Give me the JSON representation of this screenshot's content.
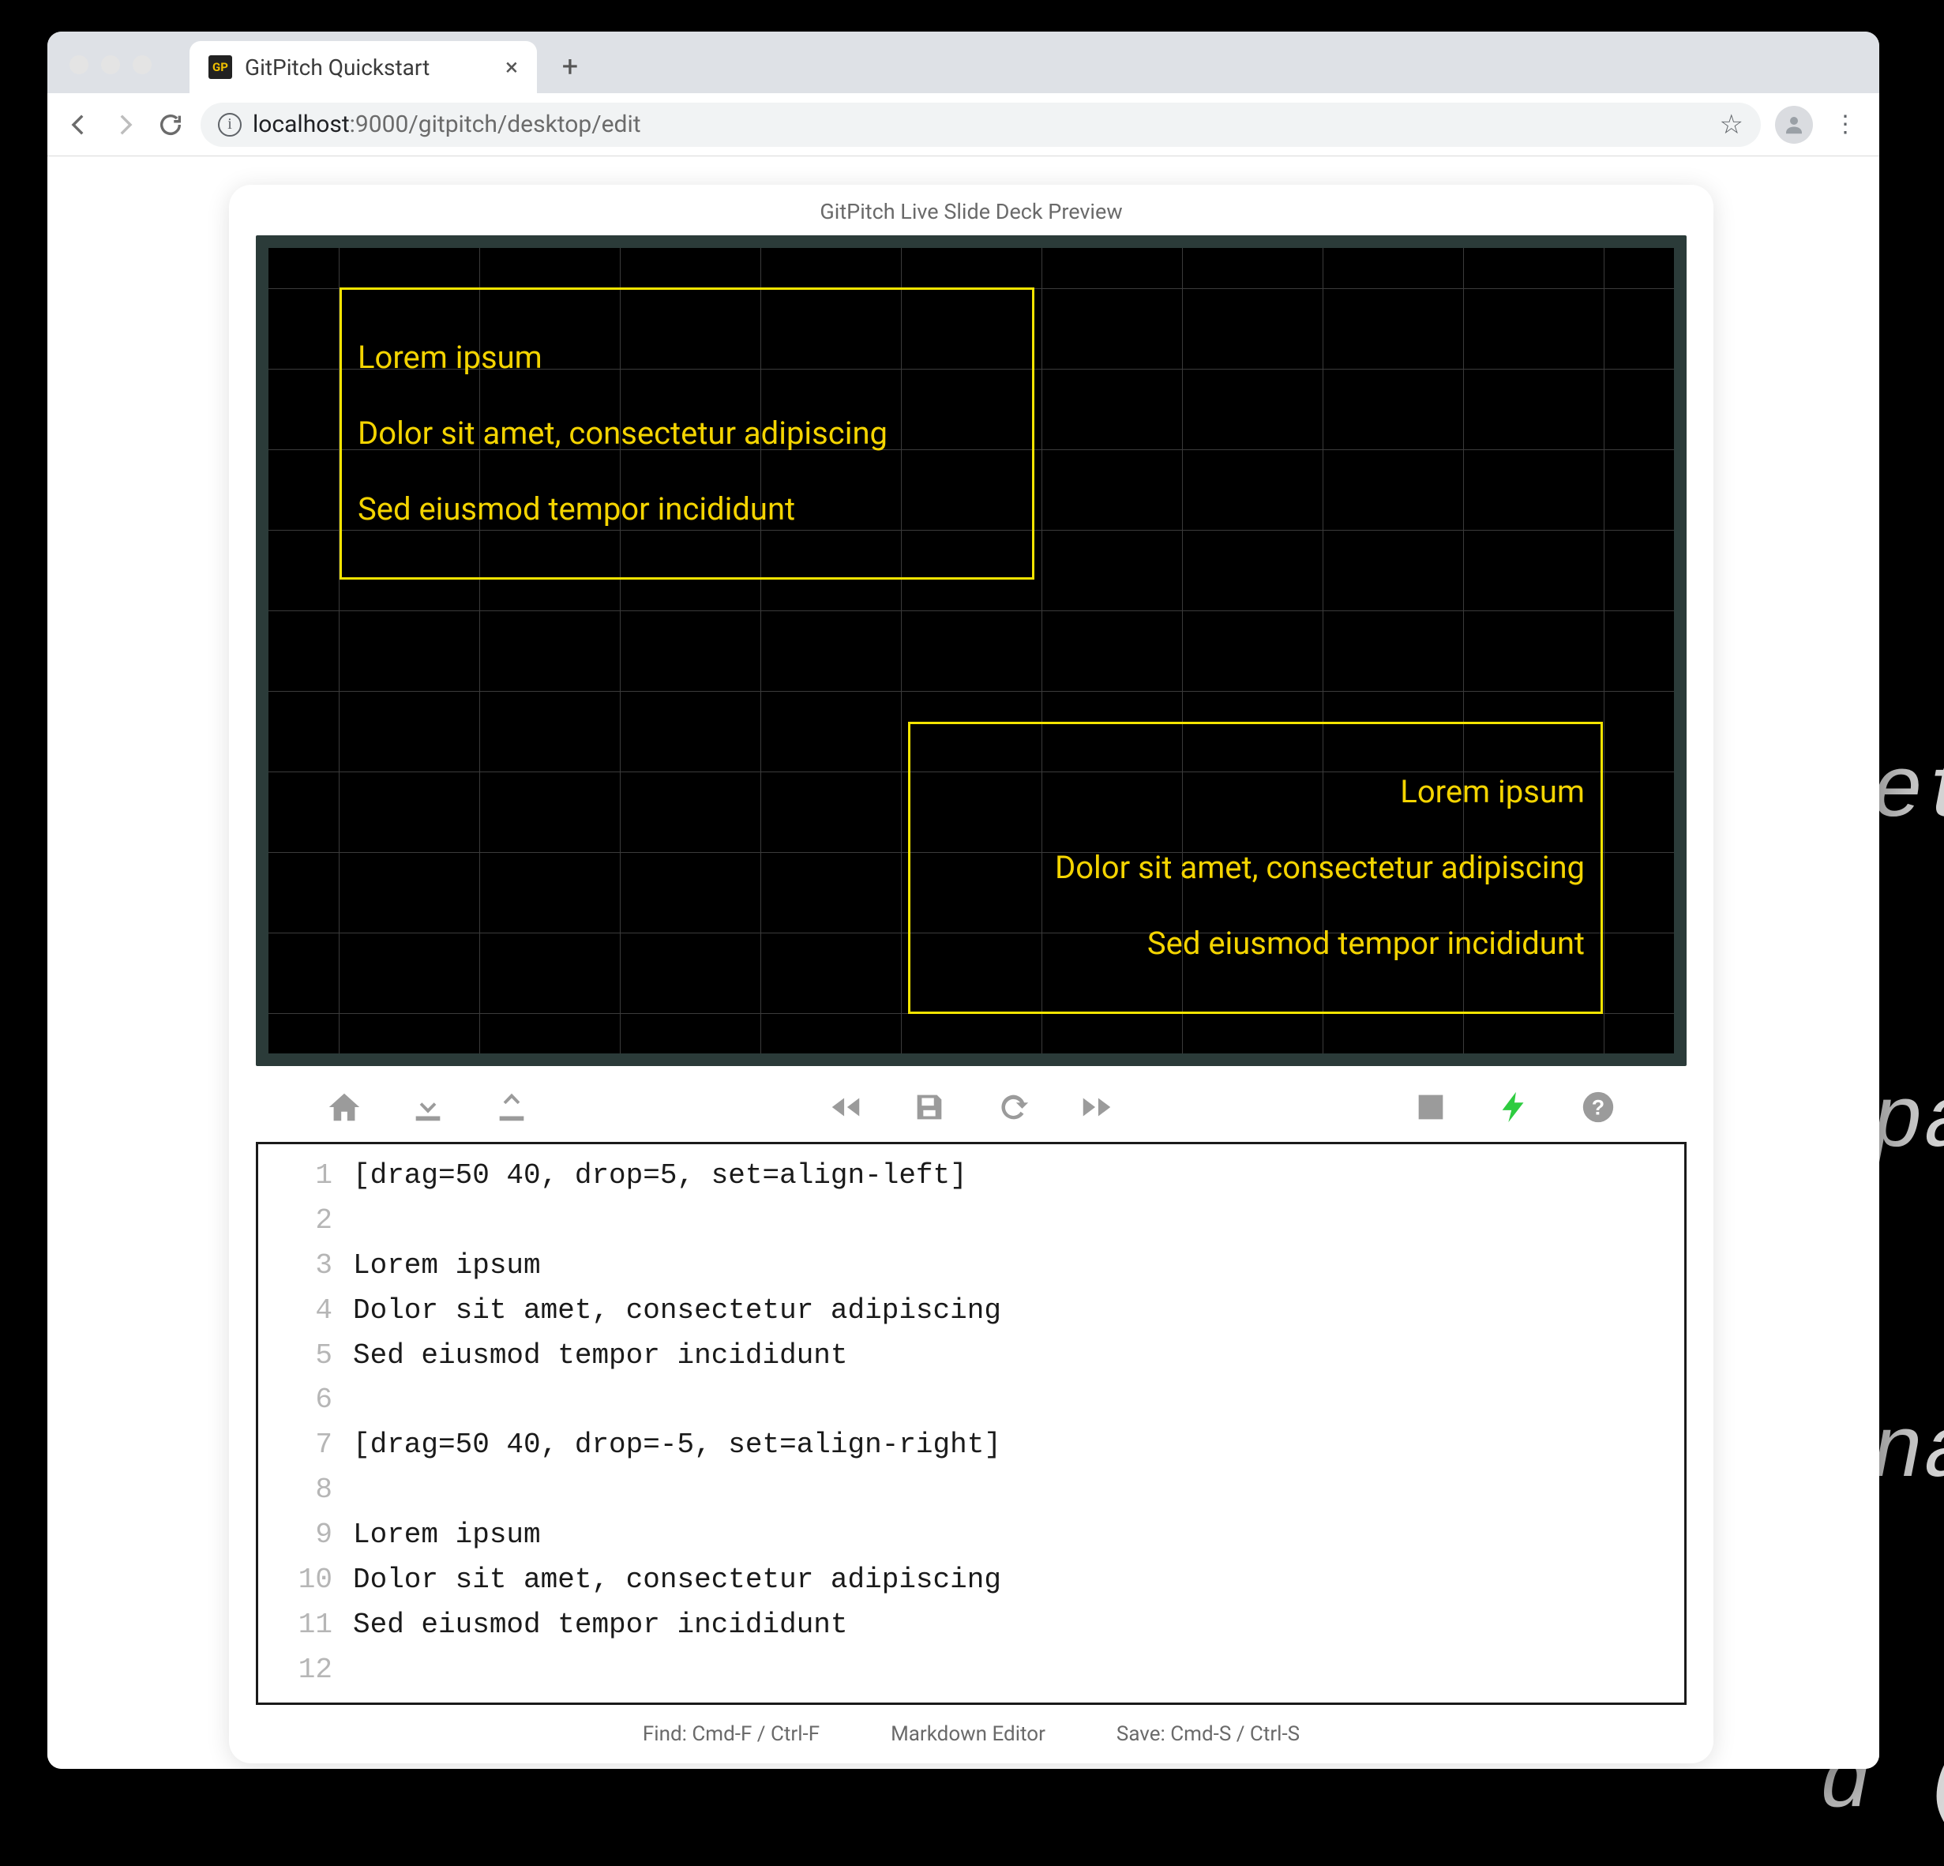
{
  "browser": {
    "tab_title": "GitPitch Quickstart",
    "favicon_text": "GP",
    "url_host": "localhost",
    "url_port": ":9000",
    "url_path": "/gitpitch/desktop/edit"
  },
  "app": {
    "header": "GitPitch Live Slide Deck Preview",
    "status_find": "Find: Cmd-F / Ctrl-F",
    "status_mode": "Markdown Editor",
    "status_save": "Save: Cmd-S / Ctrl-S"
  },
  "slide": {
    "box1": {
      "line1": "Lorem ipsum",
      "line2": "Dolor sit amet, consectetur adipiscing",
      "line3": "Sed eiusmod tempor incididunt"
    },
    "box2": {
      "line1": "Lorem ipsum",
      "line2": "Dolor sit amet, consectetur adipiscing",
      "line3": "Sed eiusmod tempor incididunt"
    }
  },
  "editor": {
    "lines": [
      "[drag=50 40, drop=5, set=align-left]",
      "",
      "Lorem ipsum",
      "Dolor sit amet, consectetur adipiscing",
      "Sed eiusmod tempor incididunt",
      "",
      "[drag=50 40, drop=-5, set=align-right]",
      "",
      "Lorem ipsum",
      "Dolor sit amet, consectetur adipiscing",
      "Sed eiusmod tempor incididunt",
      ""
    ]
  },
  "ghost": "et\n\npa\n\nna\n\nd (",
  "colors": {
    "accent_yellow": "#f4d400",
    "toolbar_green": "#2ecc40"
  }
}
